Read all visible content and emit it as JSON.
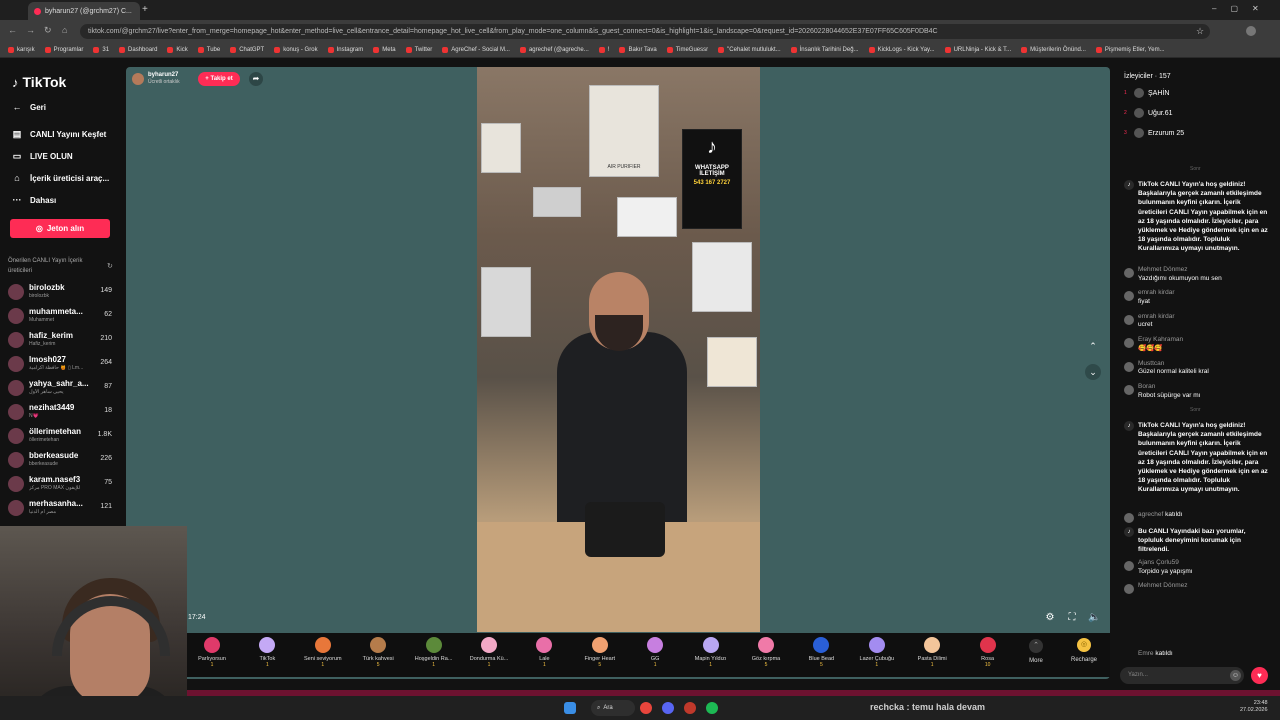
{
  "browser": {
    "tab_title": "byharun27 (@grchm27) C...",
    "url": "tiktok.com/@grchm27/live?enter_from_merge=homepage_hot&enter_method=live_cell&entrance_detail=homepage_hot_live_cell&from_play_mode=one_column&is_guest_connect=0&is_highlight=1&is_landscape=0&request_id=20260228044652E37E07FF65C605F0DB4C",
    "bookmarks": [
      "karışık",
      "Programlar",
      "31",
      "Dashboard",
      "Kick",
      "Tube",
      "ChatGPT",
      "konuş - Grok",
      "Instagram",
      "Meta",
      "Twitter",
      "AgreChef - Social M...",
      "agrechef (@agreche...",
      "!",
      "Bakır Tava",
      "TimeGuessr",
      "\"Cehalet mutlulukt...",
      "İnsanlık Tarihini Değ...",
      "KickLogs - Kick Yay...",
      "URLNinja - Kick & T...",
      "Müşterilerin Önünd...",
      "Pişmemiş Etler, Yem..."
    ]
  },
  "sidebar": {
    "logo": "TikTok",
    "back": "Geri",
    "nav": [
      "CANLI Yayını Keşfet",
      "LIVE OLUN",
      "İçerik üreticisi araç...",
      "Dahası"
    ],
    "jeton_button": "Jeton alın",
    "suggested_title": "Önerilen CANLI Yayın İçerik üreticileri",
    "accounts": [
      {
        "name": "birolozbk",
        "sub": "birolozbk",
        "count": "149"
      },
      {
        "name": "muhammeta...",
        "sub": "Muhammet",
        "count": "62"
      },
      {
        "name": "hafiz_kerim",
        "sub": "Hafiz_kerim",
        "count": "210"
      },
      {
        "name": "lmosh027",
        "sub": "حافظة أكرامية 🍯 ▯ Lm...",
        "count": "264"
      },
      {
        "name": "yahya_sahr_a...",
        "sub": "يحيى ساهر الأول",
        "count": "87"
      },
      {
        "name": "nezihat3449",
        "sub": "N💗",
        "count": "18"
      },
      {
        "name": "öllerimetehan",
        "sub": "öllerimetehan",
        "count": "1.8K"
      },
      {
        "name": "bberkeasude",
        "sub": "bberkeasude",
        "count": "226"
      },
      {
        "name": "karam.nasef3",
        "sub": "مركز PRO MAX للإيفون",
        "count": "75"
      },
      {
        "name": "merhasanha...",
        "sub": "مصر ام الدنيا",
        "count": "121"
      }
    ]
  },
  "stream": {
    "host_name": "byharun27",
    "host_sub": "Ücretli ortaklık",
    "follow_label": "+ Takip et",
    "timer": "17:24",
    "shelf_text_1": "AIR PURIFIER",
    "shelf_text_2": "WHATSAPP İLETİŞİM",
    "shelf_text_3": "543 167 2727"
  },
  "gifts": [
    {
      "name": "Parlıyorsun",
      "price": "1",
      "color": "#e03a6a"
    },
    {
      "name": "TikTok",
      "price": "1",
      "color": "#c4a9f5"
    },
    {
      "name": "Seni seviyorum",
      "price": "1",
      "color": "#e8773a"
    },
    {
      "name": "Türk kahvesi",
      "price": "5",
      "color": "#b57c4b"
    },
    {
      "name": "Hoşgeldin Ra...",
      "price": "1",
      "color": "#5c8a3a"
    },
    {
      "name": "Dondurma Kü...",
      "price": "1",
      "color": "#f2a9c6"
    },
    {
      "name": "Lale",
      "price": "1",
      "color": "#e96fa8"
    },
    {
      "name": "Finger Heart",
      "price": "5",
      "color": "#f0a070"
    },
    {
      "name": "GG",
      "price": "1",
      "color": "#c77fe0"
    },
    {
      "name": "Mapin Yıldızı",
      "price": "1",
      "color": "#b9a7f2"
    },
    {
      "name": "Göz kırpma",
      "price": "5",
      "color": "#f07aa8"
    },
    {
      "name": "Blue Bead",
      "price": "5",
      "color": "#2a5fd6"
    },
    {
      "name": "Lazer Çubuğu",
      "price": "1",
      "color": "#a38cf0"
    },
    {
      "name": "Pasta Dilimi",
      "price": "1",
      "color": "#f3c59a"
    },
    {
      "name": "Rosa",
      "price": "10",
      "color": "#e0344c"
    }
  ],
  "gift_more": "More",
  "recharge": "Recharge",
  "right_panel": {
    "viewers_title": "İzleyiciler · 157",
    "top_viewers": [
      {
        "rank": "1",
        "name": "ŞAHİN"
      },
      {
        "rank": "2",
        "name": "Uğur.61"
      },
      {
        "rank": "3",
        "name": "Erzurum 25"
      }
    ],
    "welcome_text": "TikTok CANLI Yayın'a hoş geldiniz! Başkalarıyla gerçek zamanlı etkileşimde bulunmanın keyfini çıkarın. İçerik üreticileri CANLI Yayın yapabilmek için en az 18 yaşında olmalıdır. İzleyiciler, para yüklemek ve Hediye göndermek için en az 18 yaşında olmalıdır. Topluluk Kurallarımıza uymayı unutmayın.",
    "divider_label": "Sonr",
    "comments_1": [
      {
        "user": "Mehmet Dönmez",
        "text": "Yazdığımı okumuyon mu sen"
      },
      {
        "user": "emrah kirdar",
        "text": "fiyat"
      },
      {
        "user": "emrah kirdar",
        "text": "ucret"
      },
      {
        "user": "Eray Kahraman",
        "text": "🥰🥰🥰"
      },
      {
        "user": "Musttcan",
        "text": "Güzel normal kaliteli kral"
      },
      {
        "user": "Boran",
        "text": "Robot süpürge var mı"
      }
    ],
    "join_1": {
      "user": "agrechef",
      "text": "katıldı"
    },
    "filter_notice": "Bu CANLI Yayındaki bazı yorumlar, topluluk deneyimini korumak için filtrelendi.",
    "comments_2": [
      {
        "user": "Ajans Çorlu59",
        "text": "Torpido ya yapışmı"
      },
      {
        "user": "Mehmet Dönmez",
        "text": ""
      }
    ],
    "join_2": {
      "user": "Emre",
      "text": "katıldı"
    },
    "chat_placeholder": "Yazın..."
  },
  "taskbar": {
    "search_label": "Ara",
    "ticker": "rechcka : temu hala devam",
    "time": "23:48",
    "date": "27.02.2026"
  }
}
